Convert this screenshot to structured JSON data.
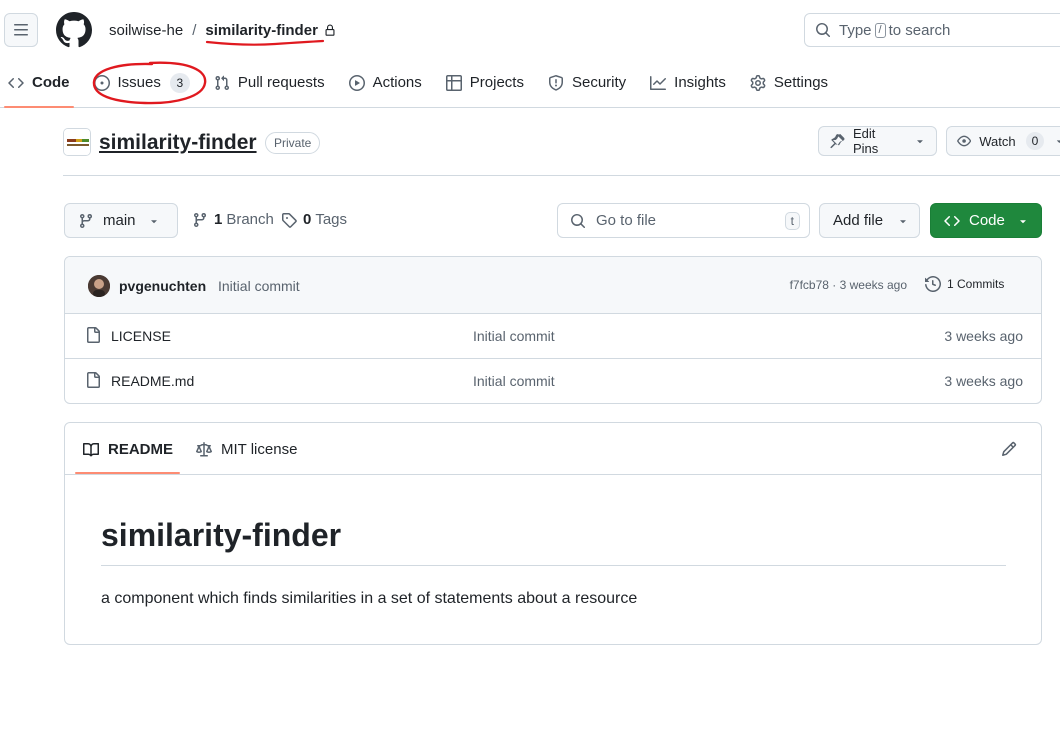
{
  "header": {
    "owner": "soilwise-he",
    "separator": "/",
    "repo": "similarity-finder",
    "search": {
      "before": "Type",
      "key": "/",
      "after": "to search"
    }
  },
  "tabs": [
    {
      "label": "Code",
      "icon": "code-icon",
      "selected": true
    },
    {
      "label": "Issues",
      "icon": "issue-opened-icon",
      "count": "3"
    },
    {
      "label": "Pull requests",
      "icon": "git-pull-request-icon"
    },
    {
      "label": "Actions",
      "icon": "play-icon"
    },
    {
      "label": "Projects",
      "icon": "table-icon"
    },
    {
      "label": "Security",
      "icon": "shield-icon"
    },
    {
      "label": "Insights",
      "icon": "graph-icon"
    },
    {
      "label": "Settings",
      "icon": "gear-icon"
    }
  ],
  "repo_header": {
    "name": "similarity-finder",
    "visibility": "Private",
    "edit_pins": "Edit Pins",
    "watch": "Watch",
    "watch_count": "0"
  },
  "controls": {
    "branch": "main",
    "branch_count": "1",
    "branch_label": "Branch",
    "tag_count": "0",
    "tag_label": "Tags",
    "goto_placeholder": "Go to file",
    "goto_key": "t",
    "add_file": "Add file",
    "code_button": "Code"
  },
  "latest_commit": {
    "author": "pvgenuchten",
    "message": "Initial commit",
    "hash_time": "f7fcb78 · 3 weeks ago",
    "commits": "1 Commits"
  },
  "files": [
    {
      "name": "LICENSE",
      "message": "Initial commit",
      "time": "3 weeks ago"
    },
    {
      "name": "README.md",
      "message": "Initial commit",
      "time": "3 weeks ago"
    }
  ],
  "readme": {
    "tab_readme": "README",
    "tab_license": "MIT license",
    "title": "similarity-finder",
    "description": "a component which finds similarities in a set of statements about a resource"
  },
  "colors": {
    "accent_underline": "#fd8c73",
    "code_button": "#1f883d",
    "annotation": "#e0191f"
  }
}
